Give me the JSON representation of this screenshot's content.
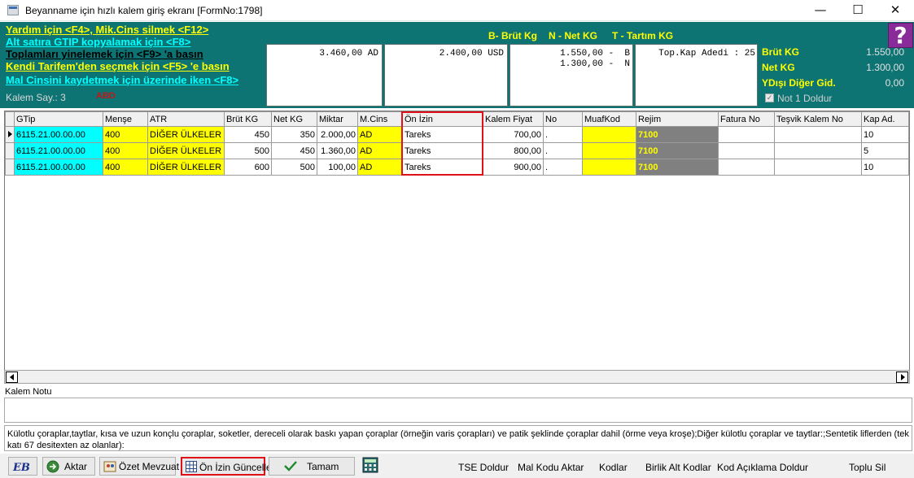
{
  "window": {
    "title": "Beyanname için hızlı kalem giriş ekranı [FormNo:1798]",
    "minimize": "—",
    "maximize": "☐",
    "close": "✕"
  },
  "header": {
    "help_lines": [
      "Yardım için <F4>, Mik.Cins silmek <F12>",
      "Alt satıra GTIP kopyalamak için <F8>",
      "Toplamları yinelemek için <F9> 'a basın",
      "Kendi Tarifem'den seçmek  için <F5> 'e basın",
      "Mal Cinsini kaydetmek için üzerinde iken <F8>"
    ],
    "kalem_say": "Kalem Say.: 3",
    "kalem_country": "ABD",
    "legend": {
      "brut": "B- Brüt Kg",
      "net": "N - Net KG",
      "tartim": "T - Tartım KG"
    },
    "boxes": {
      "box1": "3.460,00 AD",
      "box2": "2.400,00 USD",
      "box3_line1": "1.550,00 -  B",
      "box3_line2": "1.300,00 -  N",
      "box4": "Top.Kap Adedi : 25"
    },
    "right": {
      "brut_label": "Brüt KG",
      "brut_value": "1.550,00",
      "net_label": "Net KG",
      "net_value": "1.300,00",
      "ydisi_label": "YDışı Diğer Gid.",
      "ydisi_value": "0,00",
      "not1_label": "Not 1 Doldur",
      "not1_check": "✓"
    },
    "help_button": "?"
  },
  "grid": {
    "columns": [
      "GTip",
      "Menşe",
      "ATR",
      "Brüt KG",
      "Net KG",
      "Miktar",
      "M.Cins",
      "Ön İzin",
      "Kalem Fiyat",
      "No",
      "MuafKod",
      "Rejim",
      "Fatura No",
      "Teşvik Kalem No",
      "Kap Ad."
    ],
    "rows": [
      {
        "gtip": "6115.21.00.00.00",
        "mense": "400",
        "atr": "DİĞER ÜLKELER",
        "brut": "450",
        "net": "350",
        "miktar": "2.000,00",
        "mcins": "AD",
        "onizin": "Tareks",
        "fiyat": "700,00",
        "no": ".",
        "muaf": "",
        "rejim": "7100",
        "fatura": "",
        "tesvik": "",
        "kap": "10"
      },
      {
        "gtip": "6115.21.00.00.00",
        "mense": "400",
        "atr": "DİĞER ÜLKELER",
        "brut": "500",
        "net": "450",
        "miktar": "1.360,00",
        "mcins": "AD",
        "onizin": "Tareks",
        "fiyat": "800,00",
        "no": ".",
        "muaf": "",
        "rejim": "7100",
        "fatura": "",
        "tesvik": "",
        "kap": "5"
      },
      {
        "gtip": "6115.21.00.00.00",
        "mense": "400",
        "atr": "DİĞER ÜLKELER",
        "brut": "600",
        "net": "500",
        "miktar": "100,00",
        "mcins": "AD",
        "onizin": "Tareks",
        "fiyat": "900,00",
        "no": ".",
        "muaf": "",
        "rejim": "7100",
        "fatura": "",
        "tesvik": "",
        "kap": "10"
      }
    ]
  },
  "notes": {
    "kalem_notu_label": "Kalem Notu",
    "description": "Külotlu çoraplar,taytlar, kısa ve uzun konçlu çoraplar, soketler, dereceli olarak baskı yapan çoraplar (örneğin varis çorapları) ve patik şeklinde çoraplar dahil (örme veya kroşe);Diğer külotlu çoraplar ve taytlar:;Sentetik liflerden (tek katı 67 desitexten az olanlar):"
  },
  "toolbar": {
    "aktar": "Aktar",
    "ozet": "Özet Mevzuat",
    "onizin": "Ön İzin Güncelle",
    "tamam": "Tamam",
    "links": {
      "tse": "TSE Doldur",
      "malkodu": "Mal Kodu Aktar",
      "kodlar": "Kodlar",
      "birlik": "Birlik Alt Kodlar",
      "kodaciklama": "Kod Açıklama Doldur",
      "toplusil": "Toplu Sil"
    }
  },
  "colors": {
    "header_bg": "#0e7373",
    "cyan_cell": "#00ffff",
    "yellow_cell": "#ffff00",
    "rejim_cell": "#808080",
    "highlight": "#e0101a"
  }
}
